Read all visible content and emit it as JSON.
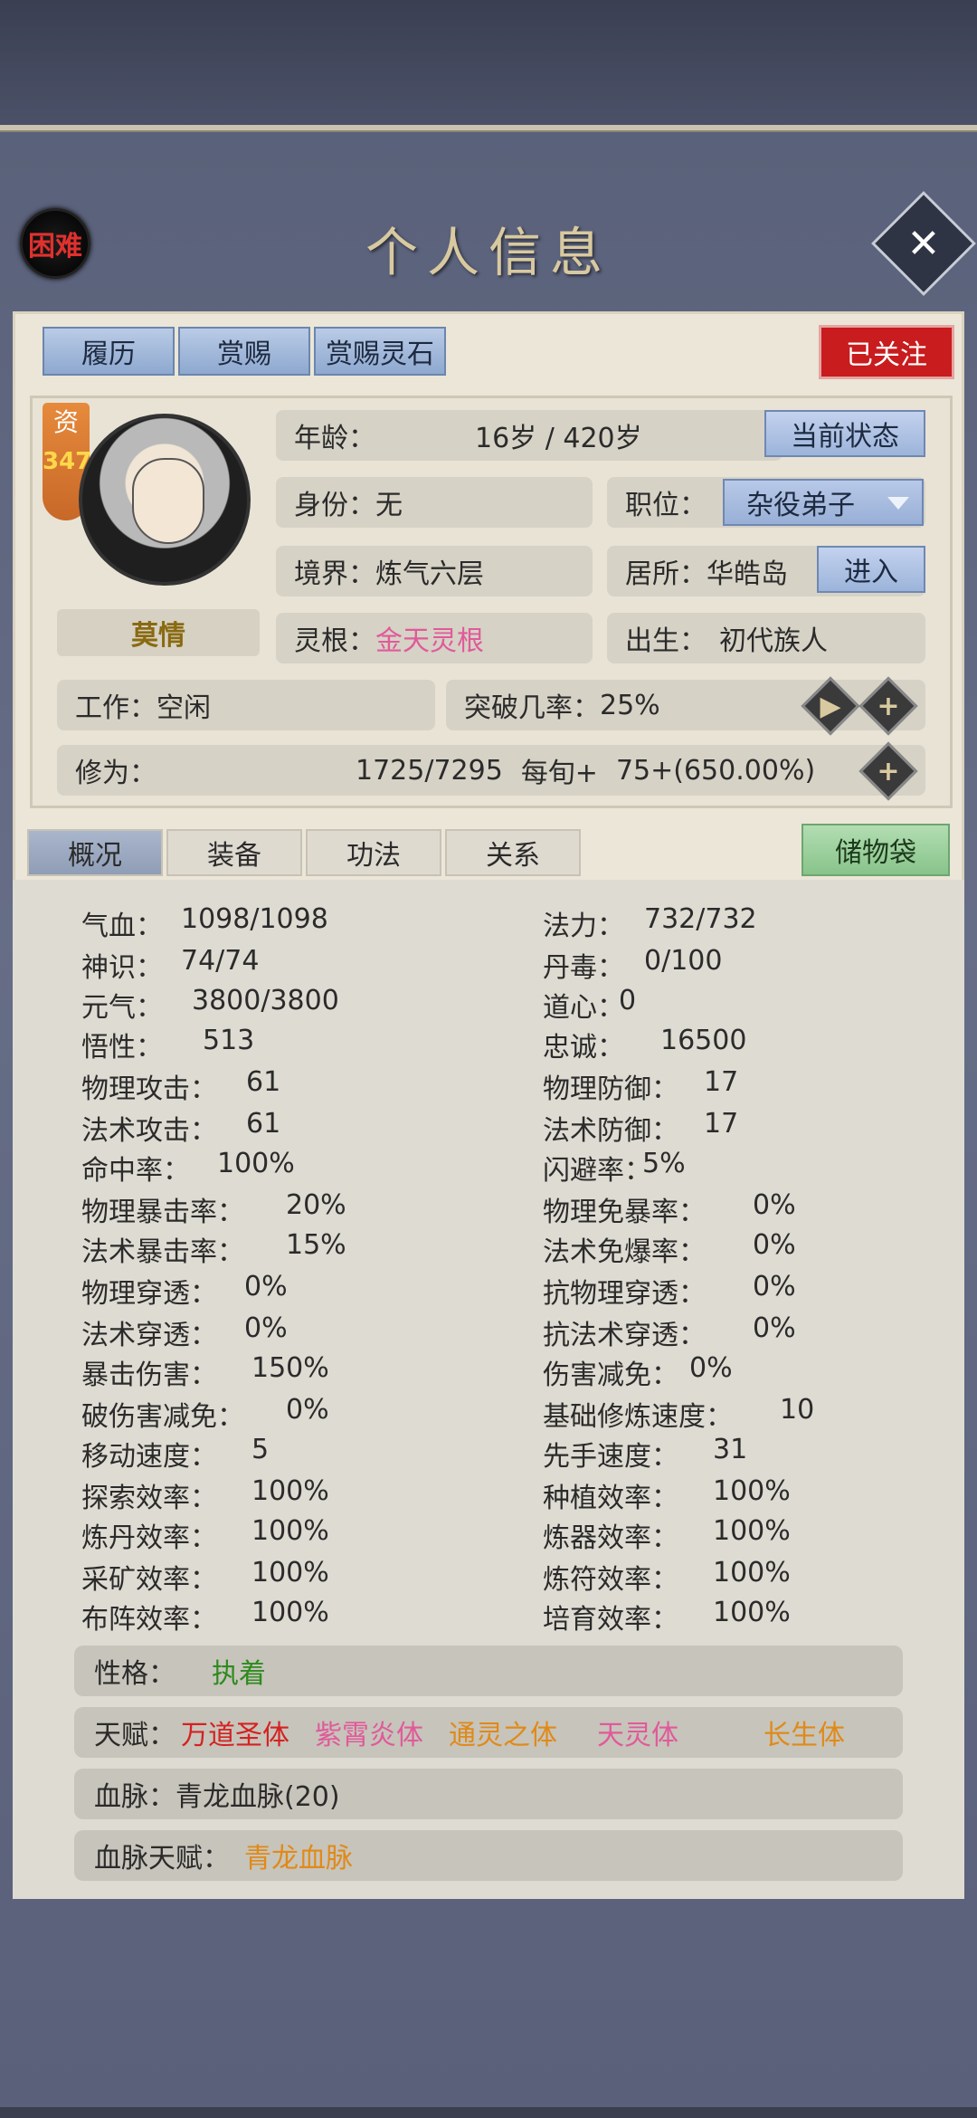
{
  "header": {
    "difficulty": "困难",
    "title": "个人信息",
    "close_icon": "close-icon"
  },
  "top_tabs": [
    "履历",
    "赏赐",
    "赏赐灵石"
  ],
  "follow_label": "已关注",
  "profile": {
    "aptitude_label": "资",
    "aptitude_value": "347",
    "name": "莫情",
    "age_label": "年龄：",
    "age_value": "16岁 / 420岁",
    "status_button": "当前状态",
    "identity_label": "身份：",
    "identity_value": "无",
    "position_label": "职位：",
    "position_value": "杂役弟子",
    "realm_label": "境界：",
    "realm_value": "炼气六层",
    "residence_label": "居所：",
    "residence_value": "华皓岛",
    "enter_button": "进入",
    "root_label": "灵根：",
    "root_value": "金天灵根",
    "birth_label": "出生：",
    "birth_value": "初代族人",
    "work_label": "工作：",
    "work_value": "空闲",
    "breakthrough_label": "突破几率：",
    "breakthrough_value": "25%",
    "cultivation_label": "修为：",
    "cultivation_value": "1725/7295",
    "cultivation_rate_label": "每旬+",
    "cultivation_rate_value": "75+(650.00%)"
  },
  "sub_tabs": [
    "概况",
    "装备",
    "功法",
    "关系"
  ],
  "bag_label": "储物袋",
  "stats_left": [
    {
      "label": "气血：",
      "value": "1098/1098"
    },
    {
      "label": "神识：",
      "value": "74/74"
    },
    {
      "label": "元气：",
      "value": "3800/3800"
    },
    {
      "label": "悟性：",
      "value": "513"
    },
    {
      "label": "物理攻击：",
      "value": "61"
    },
    {
      "label": "法术攻击：",
      "value": "61"
    },
    {
      "label": "命中率：",
      "value": "100%"
    },
    {
      "label": "物理暴击率：",
      "value": "20%"
    },
    {
      "label": "法术暴击率：",
      "value": "15%"
    },
    {
      "label": "物理穿透：",
      "value": "0%"
    },
    {
      "label": "法术穿透：",
      "value": "0%"
    },
    {
      "label": "暴击伤害：",
      "value": "150%"
    },
    {
      "label": "破伤害减免：",
      "value": "0%"
    },
    {
      "label": "移动速度：",
      "value": "5"
    },
    {
      "label": "探索效率：",
      "value": "100%"
    },
    {
      "label": "炼丹效率：",
      "value": "100%"
    },
    {
      "label": "采矿效率：",
      "value": "100%"
    },
    {
      "label": "布阵效率：",
      "value": "100%"
    }
  ],
  "stats_right": [
    {
      "label": "法力：",
      "value": "732/732"
    },
    {
      "label": "丹毒：",
      "value": "0/100"
    },
    {
      "label": "道心：",
      "value": "0"
    },
    {
      "label": "忠诚：",
      "value": "16500"
    },
    {
      "label": "物理防御：",
      "value": "17"
    },
    {
      "label": "法术防御：",
      "value": "17"
    },
    {
      "label": "闪避率：",
      "value": "5%"
    },
    {
      "label": "物理免暴率：",
      "value": "0%"
    },
    {
      "label": "法术免爆率：",
      "value": "0%"
    },
    {
      "label": "抗物理穿透：",
      "value": "0%"
    },
    {
      "label": "抗法术穿透：",
      "value": "0%"
    },
    {
      "label": "伤害减免：",
      "value": "0%"
    },
    {
      "label": "基础修炼速度：",
      "value": "10"
    },
    {
      "label": "先手速度：",
      "value": "31"
    },
    {
      "label": "种植效率：",
      "value": "100%"
    },
    {
      "label": "炼器效率：",
      "value": "100%"
    },
    {
      "label": "炼符效率：",
      "value": "100%"
    },
    {
      "label": "培育效率：",
      "value": "100%"
    }
  ],
  "traits": {
    "personality_label": "性格：",
    "personality_value": "执着",
    "talent_label": "天赋：",
    "talents": [
      "万道圣体",
      "紫霄炎体",
      "通灵之体",
      "天灵体",
      "长生体"
    ],
    "bloodline_label": "血脉：",
    "bloodline_value": "青龙血脉(20)",
    "bloodline_talent_label": "血脉天赋：",
    "bloodline_talent_value": "青龙血脉"
  },
  "colors": {
    "follow_red": "#c81c1e",
    "root_pink": "#e05a9a",
    "talent_red": "#d42222",
    "talent_orange": "#e08a18",
    "personality_green": "#2e8b1e"
  }
}
